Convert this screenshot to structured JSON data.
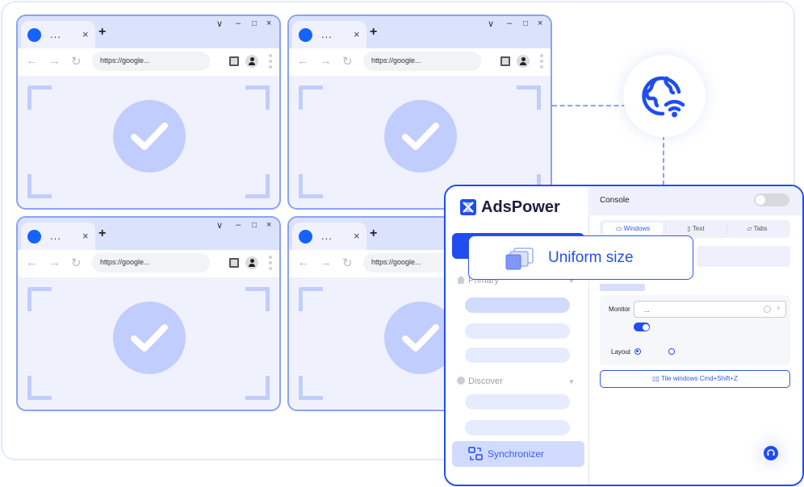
{
  "browser_windows": [
    {
      "tab_title": "...",
      "url": "https://google..."
    },
    {
      "tab_title": "...",
      "url": "https://google..."
    },
    {
      "tab_title": "...",
      "url": "https://google..."
    },
    {
      "tab_title": "...",
      "url": "https://google..."
    }
  ],
  "browser_glyphs": {
    "close": "×",
    "new_tab": "+",
    "dropdown": "⌄",
    "minimize": "–",
    "maximize": "☐",
    "close_window": "×",
    "back": "←",
    "forward": "→",
    "reload": "↻"
  },
  "adspower": {
    "brand": "AdsPower",
    "sidebar": {
      "primary_label": "Primary",
      "discover_label": "Discover",
      "synchronizer_label": "Synchronizer"
    },
    "console": {
      "title": "Console",
      "tabs": [
        {
          "label": "Windows",
          "icon": "monitor-icon",
          "active": true
        },
        {
          "label": "Text",
          "icon": "text-icon",
          "active": false
        },
        {
          "label": "Tabs",
          "icon": "folder-icon",
          "active": false
        }
      ],
      "monitor_label": "Monitor",
      "monitor_value": "...",
      "layout_label": "Layout",
      "tile_button_label": "Tile windows Cmd+Shift+Z"
    }
  },
  "callout": {
    "label": "Uniform size"
  },
  "colors": {
    "accent": "#1f4df0",
    "window_border": "#8ca2f5",
    "check_fill": "#c0cdfd"
  }
}
